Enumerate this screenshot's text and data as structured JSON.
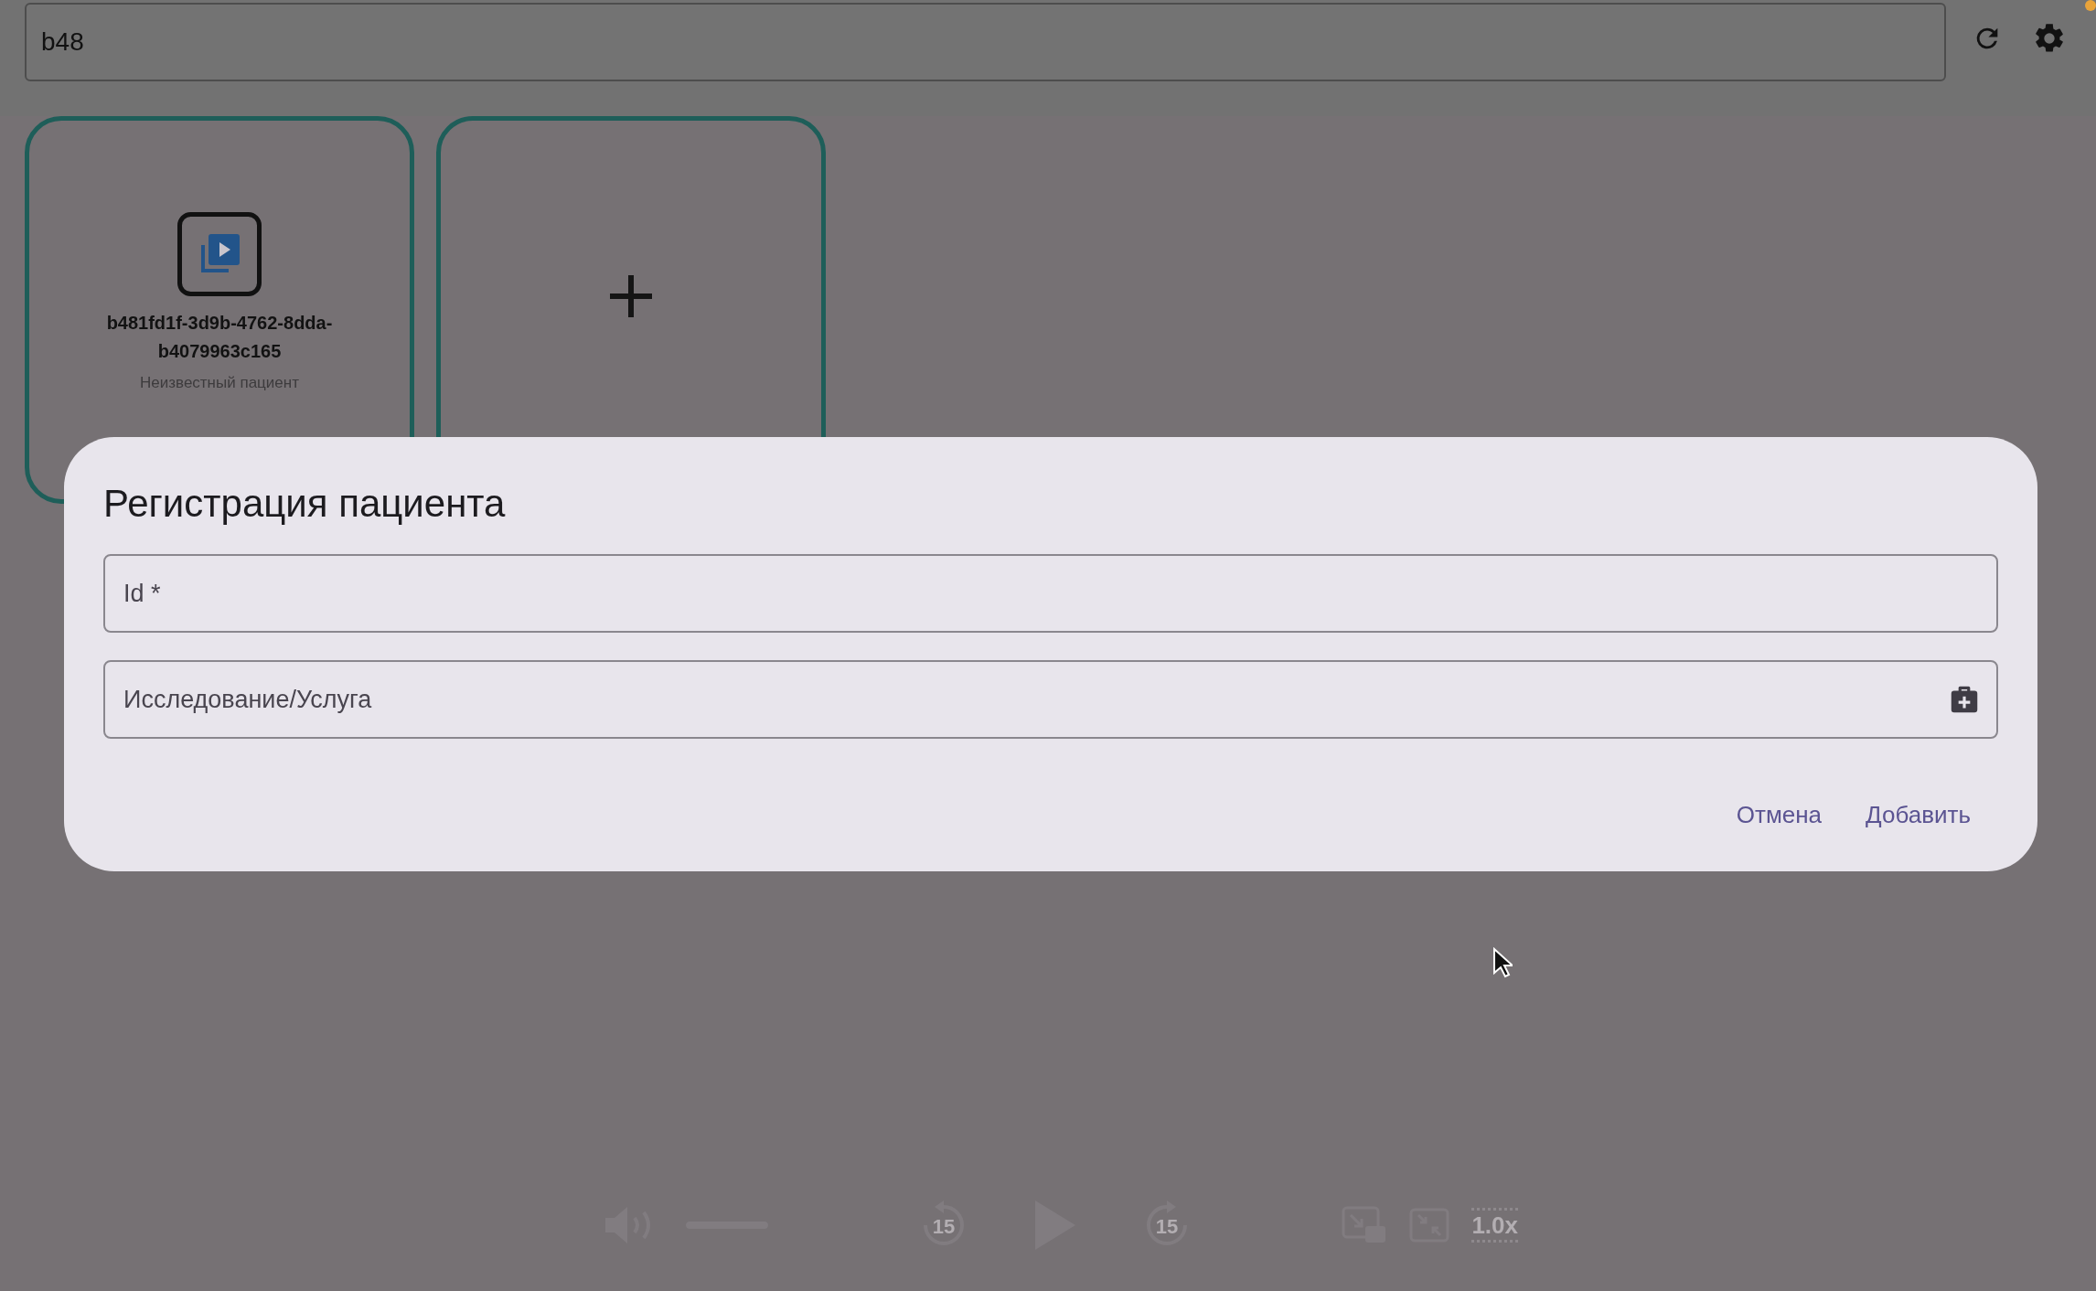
{
  "search": {
    "value": "b48"
  },
  "cards": [
    {
      "kind": "patient",
      "title": "b481fd1f-3d9b-4762-8dda-b4079963c165",
      "subtitle": "Неизвестный пациент"
    },
    {
      "kind": "add"
    }
  ],
  "dialog": {
    "title": "Регистрация пациента",
    "fields": [
      {
        "kind": "plain",
        "placeholder": "Id *"
      },
      {
        "kind": "action",
        "placeholder": "Исследование/Услуга"
      }
    ],
    "buttons": [
      "Отмена",
      "Добавить"
    ]
  },
  "player": {
    "volume": {
      "level": 1
    },
    "skip_back": "15",
    "skip_forward": "15",
    "speed": "1.0x"
  }
}
